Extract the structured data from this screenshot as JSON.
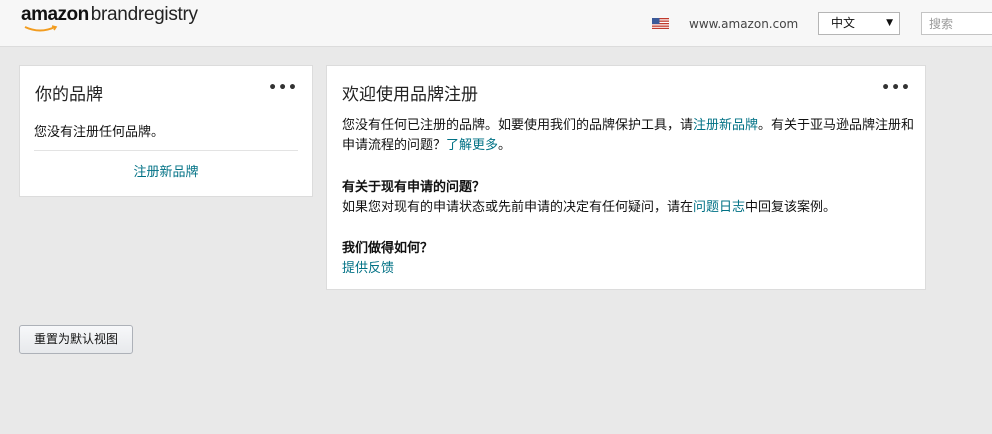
{
  "header": {
    "logo_amazon": "amazon",
    "logo_brandregistry": "brandregistry",
    "site_link": "www.amazon.com",
    "language": "中文",
    "search_placeholder": "搜索"
  },
  "brands_card": {
    "title": "你的品牌",
    "menu": "•••",
    "empty_text": "您没有注册任何品牌。",
    "register_link": "注册新品牌"
  },
  "welcome_card": {
    "title": "欢迎使用品牌注册",
    "menu": "•••",
    "intro": {
      "t1": "您没有任何已注册的品牌。如要使用我们的品牌保护工具，请",
      "link1": "注册新品牌",
      "t2": "。有关于亚马逊品牌注册和申请流程的问题？",
      "link2": "了解更多",
      "t3": "。"
    },
    "section2": {
      "heading": "有关于现有申请的问题？",
      "t1": "如果您对现有的申请状态或先前申请的决定有任何疑问，请在",
      "link": "问题日志",
      "t2": "中回复该案例。"
    },
    "section3": {
      "heading": "我们做得如何？",
      "link": "提供反馈"
    }
  },
  "reset_button": "重置为默认视图",
  "colors": {
    "link": "#007185",
    "background": "#e9e9e9",
    "logo_smile": "#f29c1f"
  },
  "icons": {
    "flag": "us-flag-icon",
    "dropdown": "dropdown-arrow-icon",
    "menu": "more-options-icon"
  }
}
